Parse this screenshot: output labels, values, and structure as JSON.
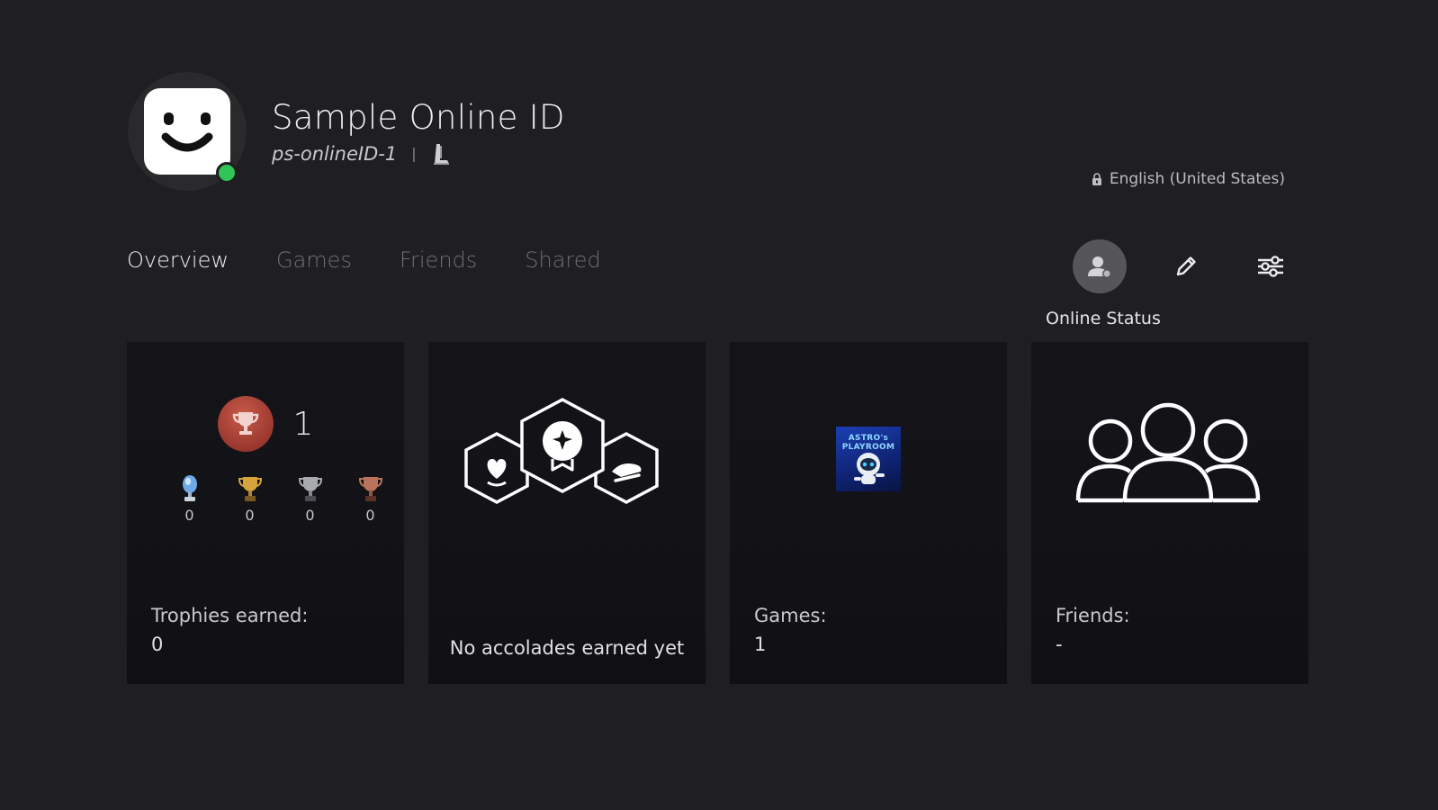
{
  "profile": {
    "display_name": "Sample Online ID",
    "online_id": "ps-onlineID-1",
    "separator": "|",
    "presence": "online",
    "presence_color": "#31c456",
    "avatar_icon": "smiley-avatar-icon",
    "platform_icon": "ps5-console-icon"
  },
  "language": {
    "icon": "lock-icon",
    "label": "English (United States)"
  },
  "tabs": [
    {
      "label": "Overview",
      "active": true
    },
    {
      "label": "Games",
      "active": false
    },
    {
      "label": "Friends",
      "active": false
    },
    {
      "label": "Shared",
      "active": false
    }
  ],
  "toolbar": {
    "online_status": {
      "icon": "online-status-person-icon",
      "label": "Online Status",
      "focused": true
    },
    "edit": {
      "icon": "pencil-icon"
    },
    "settings": {
      "icon": "sliders-icon"
    }
  },
  "cards": {
    "trophies": {
      "level": "1",
      "level_icon": "trophy-level-icon",
      "platinum": "0",
      "gold": "0",
      "silver": "0",
      "bronze": "0",
      "label": "Trophies earned:",
      "value": "0"
    },
    "accolades": {
      "icon": "accolades-hexagon-icon",
      "caption": "No accolades earned yet"
    },
    "games": {
      "game_title": "ASTRO's PLAYROOM",
      "label": "Games:",
      "value": "1"
    },
    "friends": {
      "icon": "friends-group-icon",
      "label": "Friends:",
      "value": "-"
    }
  },
  "colors": {
    "background": "#1f1f21",
    "card": "#131317",
    "active_tab": "#f2f2f4",
    "inactive_tab": "#6f6f73",
    "trophy_bronze_level": "#9d3a30"
  }
}
